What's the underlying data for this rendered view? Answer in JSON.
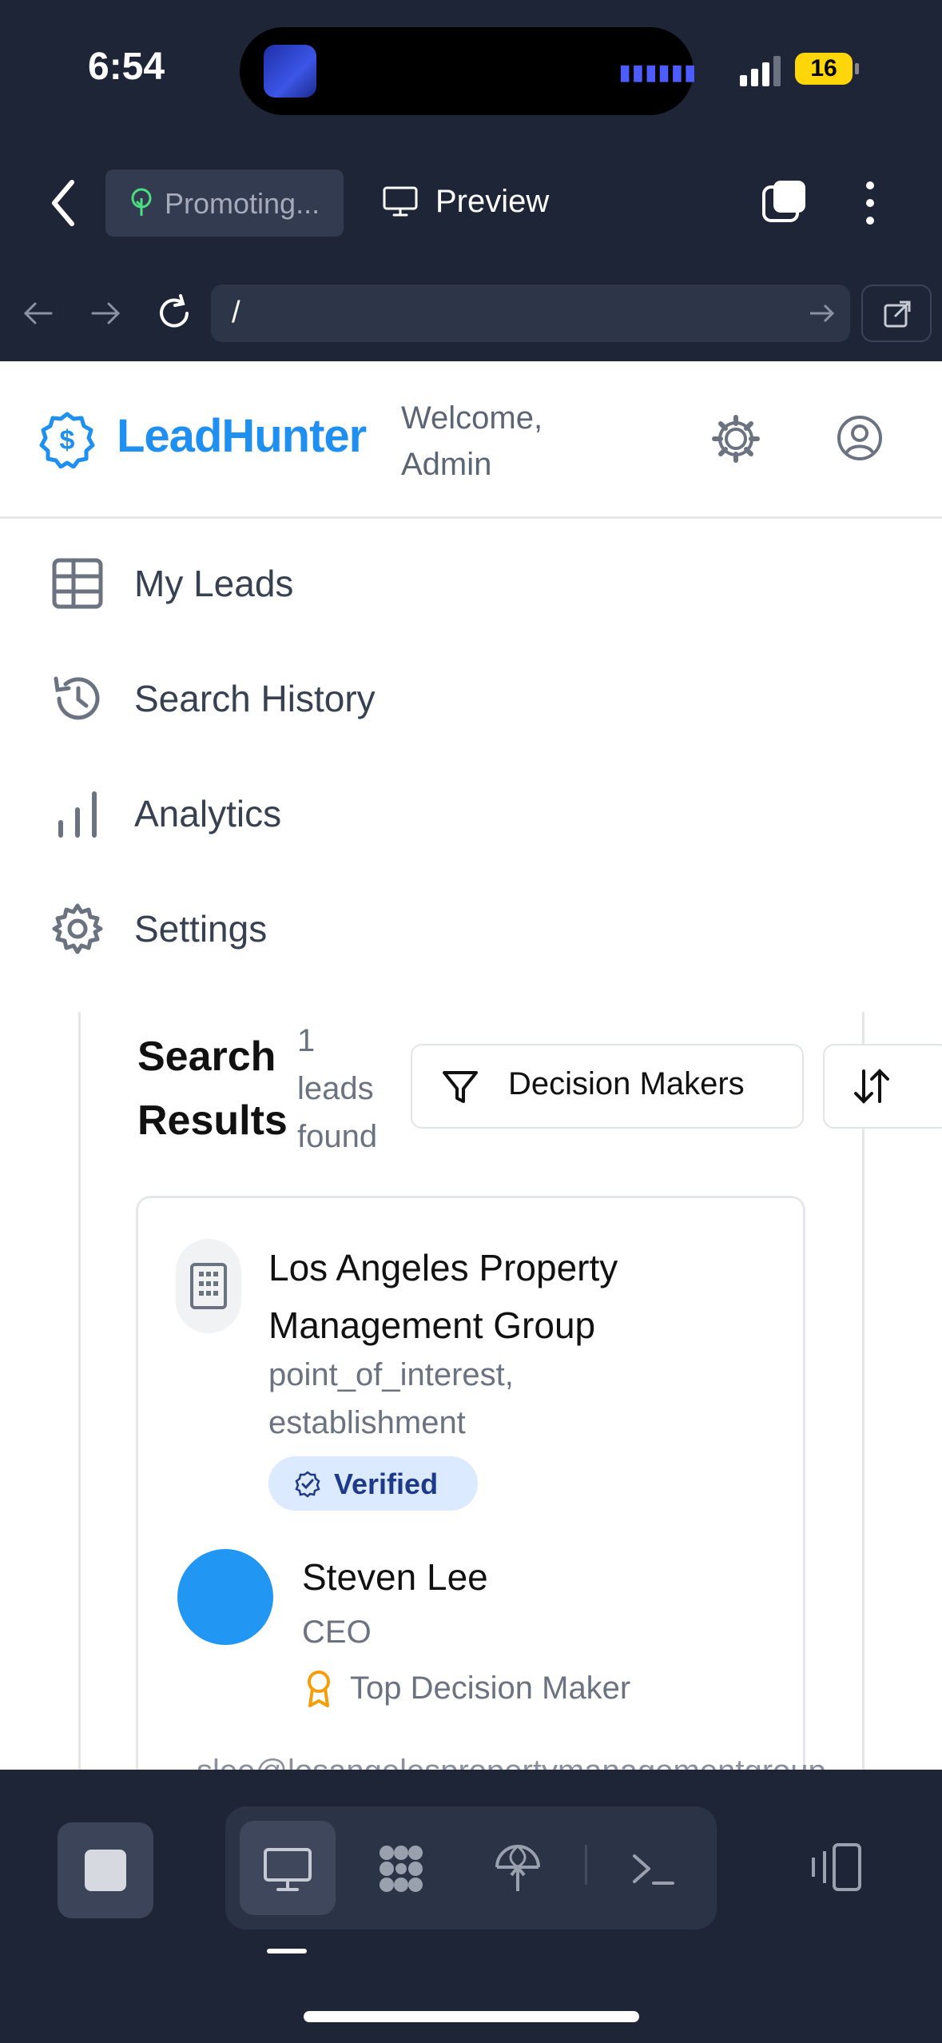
{
  "status_bar": {
    "time": "6:54",
    "battery": "16"
  },
  "app_bar": {
    "promo_label": "Promoting...",
    "preview_label": "Preview"
  },
  "url_bar": {
    "url": "/"
  },
  "header": {
    "brand": "LeadHunter",
    "welcome_line1": "Welcome,",
    "welcome_line2": "Admin"
  },
  "nav": [
    {
      "label": "My Leads",
      "icon": "table-icon"
    },
    {
      "label": "Search History",
      "icon": "history-icon"
    },
    {
      "label": "Analytics",
      "icon": "bar-chart-icon"
    },
    {
      "label": "Settings",
      "icon": "gear-icon"
    }
  ],
  "results": {
    "title_line1": "Search",
    "title_line2": "Results",
    "count_line1": "1",
    "count_line2": "leads",
    "count_line3": "found",
    "filter_label": "Decision Makers"
  },
  "lead": {
    "company_line1": "Los Angeles Property",
    "company_line2": "Management Group",
    "types_line1": "point_of_interest,",
    "types_line2": "establishment",
    "badge": "Verified",
    "contact_name": "Steven Lee",
    "contact_role": "CEO",
    "decision_label": "Top Decision Maker",
    "email_partial": "slee@losangelespropertymanagementgroup"
  },
  "colors": {
    "brand": "#1f8ff0",
    "chrome_bg": "#1e2536",
    "badge_bg": "#dbeafe",
    "badge_text": "#1e3a8a",
    "avatar": "#2196f3",
    "award": "#f59e0b"
  }
}
